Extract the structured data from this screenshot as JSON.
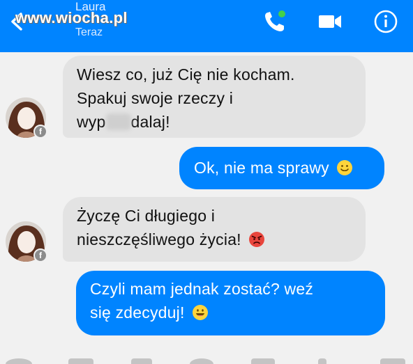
{
  "watermark": "www.wiocha.pl",
  "header": {
    "contact_name": "Laura",
    "status": "Teraz",
    "icons": [
      "back-arrow-icon",
      "phone-call-icon",
      "video-camera-icon",
      "info-icon"
    ],
    "accent_color": "#0084ff",
    "online_dot_color": "#44d14a"
  },
  "messages": [
    {
      "side": "incoming",
      "lines": [
        "Wiesz co, już Cię nie kocham.",
        "Spakuj swoje rzeczy i"
      ],
      "last_prefix": "wyp",
      "last_suffix": "dalaj!",
      "censored": true
    },
    {
      "side": "outgoing",
      "text": "Ok, nie ma sprawy",
      "emoji": "slightly-smiling-face"
    },
    {
      "side": "incoming",
      "lines": [
        "Życzę Ci długiego i"
      ],
      "last_text": "nieszczęśliwego życia!",
      "emoji": "angry-face"
    },
    {
      "side": "outgoing",
      "lines": [
        "Czyli mam jednak zostać? weź"
      ],
      "last_text": "się zdecyduj!",
      "emoji": "grinning-face"
    }
  ],
  "avatar_badge": "f",
  "colors": {
    "incoming_bubble": "#e3e3e3",
    "outgoing_bubble": "#0084ff",
    "background": "#f1f1f1"
  }
}
